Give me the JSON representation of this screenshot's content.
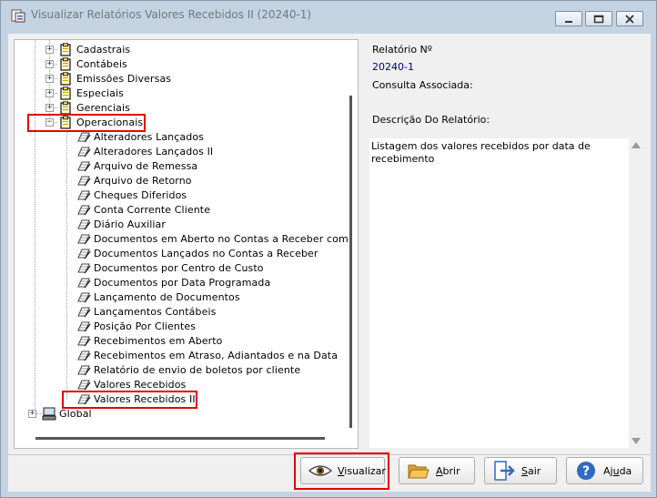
{
  "window": {
    "title": "Visualizar Relatórios Valores Recebidos II (20240-1)"
  },
  "tree": {
    "groups": [
      {
        "label": "Cadastrais",
        "expanded": false
      },
      {
        "label": "Contábeis",
        "expanded": false
      },
      {
        "label": "Emissões Diversas",
        "expanded": false
      },
      {
        "label": "Especiais",
        "expanded": false
      },
      {
        "label": "Gerenciais",
        "expanded": false
      },
      {
        "label": "Operacionais",
        "expanded": true
      }
    ],
    "reports": [
      "Alteradores  Lançados",
      "Alteradores  Lançados II",
      "Arquivo de Remessa",
      "Arquivo de Retorno",
      "Cheques Diferidos",
      "Conta Corrente Cliente",
      "Diário  Auxiliar",
      "Documentos em Aberto no Contas a Receber com Alte",
      "Documentos Lançados no Contas a Receber",
      "Documentos por Centro de Custo",
      "Documentos por Data Programada",
      "Lançamento  de Documentos",
      "Lançamentos Contábeis",
      "Posição Por Clientes",
      "Recebimentos em Aberto",
      "Recebimentos em Atraso, Adiantados e na Data",
      "Relatório de envio de boletos por cliente",
      "Valores Recebidos",
      "Valores Recebidos II"
    ],
    "selected_report": "Valores Recebidos II",
    "root": "Global"
  },
  "details": {
    "report_number_label": "Relatório Nº",
    "report_number_value": "20240-1",
    "query_label": "Consulta Associada:",
    "description_label": "Descrição Do Relatório:",
    "description_text": "Listagem dos valores recebidos por data de recebimento"
  },
  "buttons": {
    "view": {
      "label_rest": "isualizar",
      "mnemonic": "V"
    },
    "open": {
      "label_rest": "brir",
      "mnemonic": "A"
    },
    "exit": {
      "label_rest": "air",
      "mnemonic": "S"
    },
    "help": {
      "label_pre": "Aj",
      "mnemonic": "u",
      "label_post": "da"
    }
  },
  "colors": {
    "highlight": "#e20000",
    "link_value": "#000080",
    "window_bg": "#c4d3e2",
    "panel_bg": "#f0f0f0"
  },
  "icons": {
    "app": "report-app-icon",
    "folder": "clipboard-folder-icon",
    "report": "report-pencil-icon",
    "global": "computer-icon",
    "view": "eye-icon",
    "open": "open-folder-icon",
    "exit": "exit-door-icon",
    "help": "help-question-icon"
  }
}
